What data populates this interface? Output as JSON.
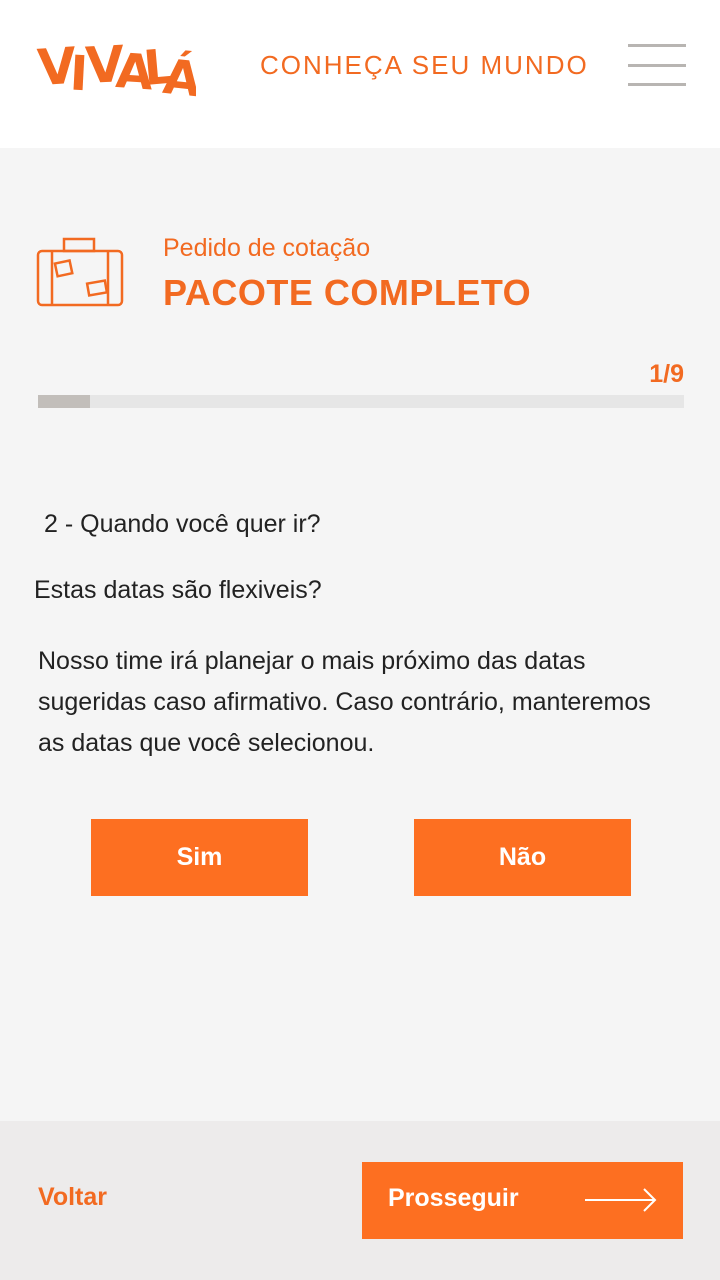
{
  "header": {
    "logo_text": "VIVALÁ",
    "tagline": "CONHEÇA SEU MUNDO",
    "menu_icon": "hamburger-menu-icon"
  },
  "quote": {
    "icon": "suitcase-icon",
    "subtitle": "Pedido de cotação",
    "title": "PACOTE COMPLETO"
  },
  "progress": {
    "label": "1/9",
    "fraction": 0.08
  },
  "question": {
    "text": "2 - Quando você quer ir?",
    "sub_question": "Estas datas são flexiveis?",
    "description": "Nosso time irá planejar o mais próximo das datas sugeridas caso afirmativo. Caso contrário, manteremos as datas que você selecionou."
  },
  "choices": {
    "yes": "Sim",
    "no": "Não"
  },
  "footer": {
    "back_label": "Voltar",
    "next_label": "Prosseguir",
    "next_icon": "arrow-right-icon"
  },
  "colors": {
    "accent": "#fd6f21",
    "accent_text": "#f26a21",
    "progress_fill": "#c2beba",
    "progress_track": "#e6e6e6",
    "footer_bg": "#edebeb",
    "page_bg": "#f5f5f5"
  }
}
